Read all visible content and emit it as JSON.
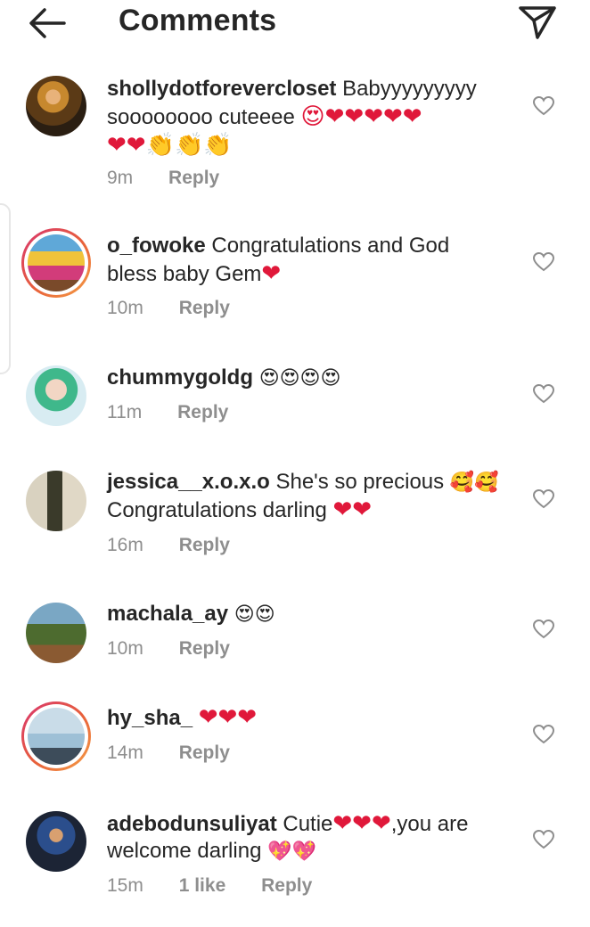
{
  "header": {
    "title": "Comments",
    "back_icon": "arrow-left-icon",
    "send_icon": "paper-plane-icon"
  },
  "colors": {
    "text": "#262626",
    "secondary": "#8e8e8e",
    "heart": "#e0183a",
    "story_ring_start": "#d8356f",
    "story_ring_end": "#f5a045"
  },
  "comments": [
    {
      "username": "shollydotforevercloset",
      "text_a": " Babyyyyyyyyy",
      "text_b": "soooooooo cuteeee ",
      "emojis_a": "😍❤❤❤❤❤",
      "emojis_b": "❤❤👏👏👏",
      "time": "9m",
      "reply": "Reply",
      "story_ring": false
    },
    {
      "username": "o_fowoke",
      "text_a": " Congratulations and God",
      "text_b": "bless baby Gem",
      "emojis_b": "❤",
      "time": "10m",
      "reply": "Reply",
      "story_ring": true
    },
    {
      "username": "chummygoldg",
      "emojis_a": "😍😍😍😍",
      "time": "11m",
      "reply": "Reply",
      "story_ring": false
    },
    {
      "username": "jessica__x.o.x.o",
      "text_a": " She's so precious ",
      "emojis_a": "🥰🥰",
      "text_b": "Congratulations darling ",
      "emojis_b": "❤❤",
      "time": "16m",
      "reply": "Reply",
      "story_ring": false
    },
    {
      "username": "machala_ay",
      "emojis_a": "😍😍",
      "time": "10m",
      "reply": "Reply",
      "story_ring": false
    },
    {
      "username": "hy_sha_",
      "emojis_a": "❤❤❤",
      "time": "14m",
      "reply": "Reply",
      "story_ring": true
    },
    {
      "username": "adebodunsuliyat",
      "text_a": " Cutie",
      "emojis_a": "❤❤❤",
      "text_a2": ",you are",
      "text_b": "welcome darling ",
      "emojis_b": "💖💖",
      "time": "15m",
      "likes": "1 like",
      "reply": "Reply",
      "story_ring": false
    }
  ]
}
